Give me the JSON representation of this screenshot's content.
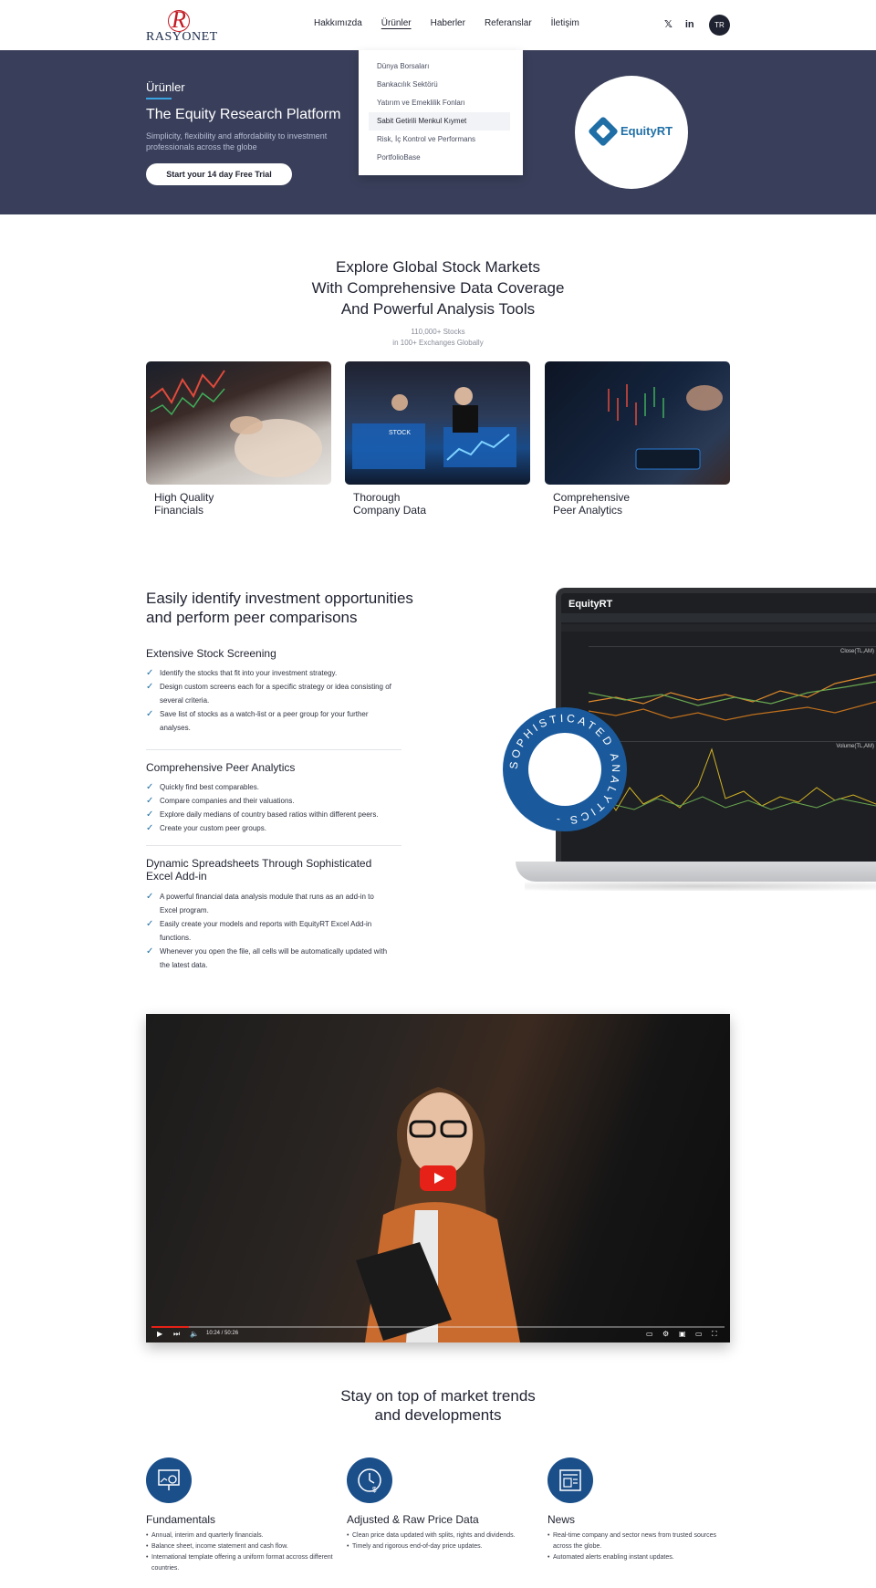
{
  "brand": {
    "logo_letter": "R",
    "logo_text": "RASYONET",
    "color_primary": "#1b4f8a",
    "color_hero": "#393f5a",
    "color_accent": "#3aa3e0",
    "color_logo": "#c41a24"
  },
  "nav": {
    "items": [
      "Hakkımızda",
      "Ürünler",
      "Haberler",
      "Referanslar",
      "İletişim"
    ],
    "active": "Ürünler",
    "social": [
      "twitter-icon",
      "linkedin-icon"
    ],
    "lang": "TR",
    "social_glyphs": [
      "𝕏",
      "in"
    ]
  },
  "dropdown": {
    "items": [
      "Dünya Borsaları",
      "Bankacılık Sektörü",
      "Yatırım ve Emeklilik Fonları",
      "Sabit Getirili Menkul Kıymet",
      "Risk, İç Kontrol ve Performans",
      "PortfolioBase"
    ],
    "hovered": "Sabit Getirili Menkul Kıymet"
  },
  "hero": {
    "eyebrow": "Ürünler",
    "title": "The Equity Research Platform",
    "subtitle": "Simplicity, flexibility and affordability to investment professionals across the globe",
    "cta": "Start your 14 day Free Trial",
    "product_logo": "EquityRT"
  },
  "explore": {
    "title_line1": "Explore Global Stock Markets",
    "title_line2": "With Comprehensive Data Coverage",
    "title_line3": "And Powerful Analysis Tools",
    "meta_line1": "110,000+ Stocks",
    "meta_line2": "in 100+ Exchanges Globally",
    "cards": [
      {
        "line1": "High Quality",
        "line2": "Financials"
      },
      {
        "line1": "Thorough",
        "line2": "Company Data"
      },
      {
        "line1": "Comprehensive",
        "line2": "Peer Analytics"
      }
    ],
    "card2_label": "STOCK"
  },
  "features": {
    "title_line1": "Easily identify investment opportunities",
    "title_line2": "and perform peer comparisons",
    "sections": [
      {
        "head": "Extensive Stock Screening",
        "items": [
          "Identify the stocks that fit into your investment strategy.",
          "Design custom screens each for a specific strategy or idea consisting of several criteria.",
          "Save list of stocks as a watch-list or a peer group for your further analyses."
        ]
      },
      {
        "head": "Comprehensive Peer Analytics",
        "items": [
          "Quickly find best comparables.",
          "Compare companies and their valuations.",
          "Explore daily medians of country based ratios within different peers.",
          "Create your custom peer groups."
        ]
      },
      {
        "head_line1": "Dynamic Spreadsheets Through Sophisticated",
        "head_line2": "Excel Add-in",
        "items": [
          "A powerful financial data analysis module that runs as an add-in to Excel program.",
          "Easily create your models and reports with EquityRT Excel Add-in functions.",
          "Whenever you open the file, all cells will be automatically updated with the latest data."
        ]
      }
    ],
    "laptop_logo": "EquityRT",
    "plot1_label": "Close(TL,AM)",
    "plot2_label": "Volume(TL,AM)",
    "badge_text": "SOPHISTICATED ANALYTICS -"
  },
  "video": {
    "time": "10:24 / 50:26",
    "progress_fraction": 0.065
  },
  "trends": {
    "title_line1": "Stay on top of market trends",
    "title_line2": "and developments",
    "services": [
      {
        "icon": "presentation-chart-icon",
        "title": "Fundamentals",
        "items": [
          "Annual, interim and quarterly financials.",
          "Balance sheet, income statement and cash flow.",
          "International template offering a uniform format accross different countries."
        ]
      },
      {
        "icon": "clock-dollar-icon",
        "title": "Adjusted & Raw Price Data",
        "items": [
          "Clean price data updated with splits, rights and dividends.",
          "Timely and rigorous end-of-day price updates."
        ]
      },
      {
        "icon": "newspaper-icon",
        "title": "News",
        "items": [
          "Real-time company and sector news from trusted sources across the globe.",
          "Automated alerts enabling instant updates."
        ]
      }
    ]
  }
}
